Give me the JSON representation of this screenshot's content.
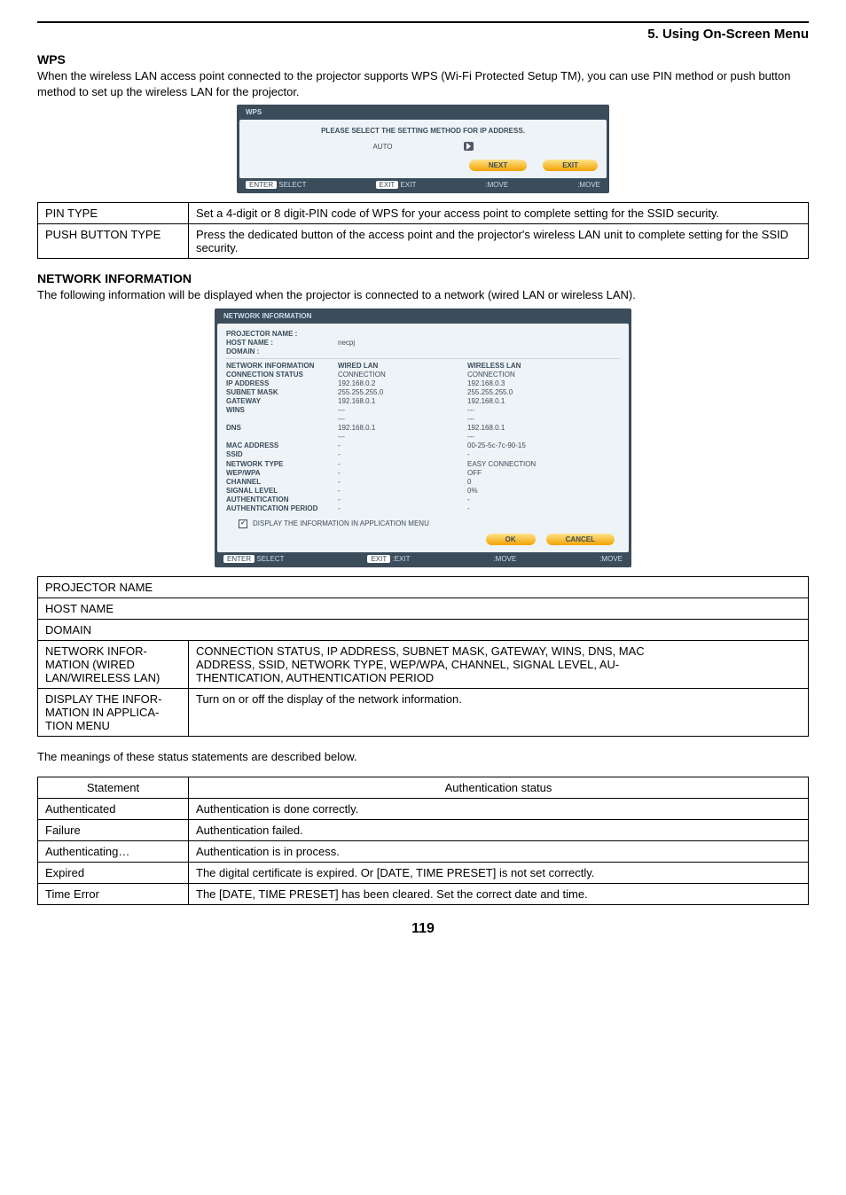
{
  "header": {
    "title": "5. Using On-Screen Menu"
  },
  "wps": {
    "heading": "WPS",
    "intro": "When the wireless LAN access point connected to the projector supports WPS (Wi-Fi Protected Setup TM), you can use PIN method or push button method to set up the wireless LAN for the projector.",
    "dialog": {
      "title": "WPS",
      "message": "PLEASE SELECT THE SETTING METHOD FOR IP ADDRESS.",
      "option": "AUTO",
      "next": "NEXT",
      "exit": "EXIT",
      "footer_select": "SELECT",
      "footer_exit": "EXIT",
      "footer_move1": ":MOVE",
      "footer_move2": ":MOVE"
    },
    "rows": [
      {
        "label": "PIN TYPE",
        "desc": "Set a 4-digit or 8 digit-PIN code of WPS for your access point to complete setting for the SSID security."
      },
      {
        "label": "PUSH BUTTON TYPE",
        "desc": "Press the dedicated button of the access point and the projector's wireless LAN unit to complete setting for the SSID security."
      }
    ]
  },
  "netinfo": {
    "heading": "NETWORK INFORMATION",
    "intro": "The following information will be displayed when the projector is connected to a network (wired LAN or wireless LAN).",
    "dialog": {
      "title": "NETWORK INFORMATION",
      "projector_name_label": "PROJECTOR NAME :",
      "host_name_label": "HOST NAME :",
      "host_name_value": "necpj",
      "domain_label": "DOMAIN :",
      "col_header": "NETWORK INFORMATION",
      "col_wired": "WIRED LAN",
      "col_wireless": "WIRELESS LAN",
      "rows": [
        {
          "l": "CONNECTION STATUS",
          "a": "CONNECTION",
          "b": "CONNECTION"
        },
        {
          "l": "IP ADDRESS",
          "a": "192.168.0.2",
          "b": "192.168.0.3"
        },
        {
          "l": "SUBNET MASK",
          "a": "255.255.255.0",
          "b": "255.255.255.0"
        },
        {
          "l": "GATEWAY",
          "a": "192.168.0.1",
          "b": "192.168.0.1"
        },
        {
          "l": "WINS",
          "a": "---",
          "b": "---"
        },
        {
          "l": "",
          "a": "---",
          "b": "---"
        },
        {
          "l": "DNS",
          "a": "192.168.0.1",
          "b": "192.168.0.1"
        },
        {
          "l": "",
          "a": "---",
          "b": "---"
        },
        {
          "l": "MAC ADDRESS",
          "a": "-",
          "b": "00-25-5c-7c-90-15"
        },
        {
          "l": "SSID",
          "a": "-",
          "b": "-"
        },
        {
          "l": "",
          "a": "",
          "b": ""
        },
        {
          "l": "NETWORK TYPE",
          "a": "-",
          "b": "EASY CONNECTION"
        },
        {
          "l": "WEP/WPA",
          "a": "-",
          "b": "OFF"
        },
        {
          "l": "CHANNEL",
          "a": "-",
          "b": "0"
        },
        {
          "l": "SIGNAL LEVEL",
          "a": "-",
          "b": "0%"
        },
        {
          "l": "AUTHENTICATION",
          "a": "-",
          "b": "-"
        },
        {
          "l": "AUTHENTICATION PERIOD",
          "a": "-",
          "b": "-"
        }
      ],
      "checkbox": "DISPLAY THE INFORMATION IN APPLICATION MENU",
      "ok": "OK",
      "cancel": "CANCEL",
      "footer_select": "SELECT",
      "footer_exit": ":EXIT",
      "footer_move1": ":MOVE",
      "footer_move2": ":MOVE"
    },
    "rows": [
      {
        "label": "PROJECTOR NAME",
        "desc": ""
      },
      {
        "label": "HOST NAME",
        "desc": ""
      },
      {
        "label": "DOMAIN",
        "desc": ""
      },
      {
        "label": "NETWORK INFORMATION (WIRED LAN/WIRELESS LAN)",
        "desc": "CONNECTION STATUS, IP ADDRESS, SUBNET MASK, GATEWAY, WINS, DNS, MAC ADDRESS, SSID, NETWORK TYPE, WEP/WPA, CHANNEL, SIGNAL LEVEL, AUTHENTICATION, AUTHENTICATION PERIOD"
      },
      {
        "label": "DISPLAY THE INFORMATION IN APPLICATION MENU",
        "desc": "Turn on or off the display of the network information."
      }
    ]
  },
  "status": {
    "intro": "The meanings of these status statements are described below.",
    "header_statement": "Statement",
    "header_auth": "Authentication status",
    "rows": [
      {
        "s": "Authenticated",
        "d": "Authentication is done correctly."
      },
      {
        "s": "Failure",
        "d": "Authentication failed."
      },
      {
        "s": "Authenticating…",
        "d": "Authentication is in process."
      },
      {
        "s": "Expired",
        "d": "The digital certificate is expired. Or [DATE, TIME PRESET] is not set correctly."
      },
      {
        "s": "Time Error",
        "d": "The [DATE, TIME PRESET] has been cleared. Set the correct date and time."
      }
    ]
  },
  "page": "119"
}
